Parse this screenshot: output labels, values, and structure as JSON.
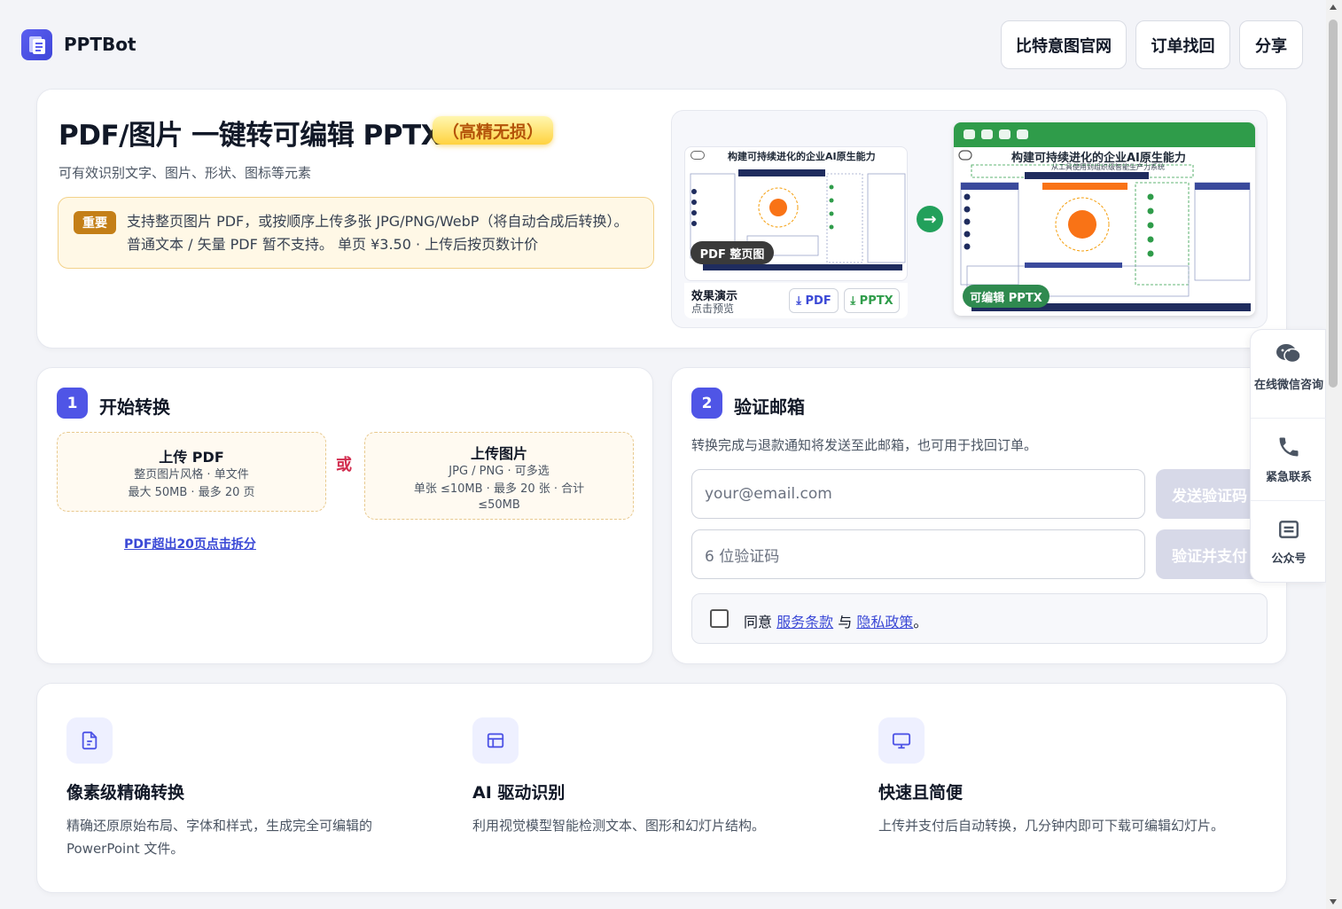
{
  "header": {
    "brand": "PPTBot",
    "buttons": [
      "比特意图官网",
      "订单找回",
      "分享"
    ]
  },
  "hero": {
    "title": "PDF/图片 一键转可编辑 PPTX",
    "badge": "（高精无损）",
    "subtitle": "可有效识别文字、图片、形状、图标等元素",
    "notice_tag": "重要",
    "notice_text": "支持整页图片 PDF，或按顺序上传多张 JPG/PNG/WebP（将自动合成后转换）。普通文本 / 矢量 PDF 暂不支持。 单页 ¥3.50 · 上传后按页数计价"
  },
  "preview": {
    "slide_title": "构建可持续进化的企业AI原生能力",
    "slide_subtitle": "从工具使用到组织级智能生产力系统",
    "left_caption": "PDF 整页图",
    "right_caption": "可编辑 PPTX",
    "demo_title": "效果演示",
    "demo_sub": "点击预览",
    "download_pdf": "⤓ PDF",
    "download_pptx": "⤓ PPTX"
  },
  "step1": {
    "num": "1",
    "title": "开始转换",
    "pdf_title": "上传 PDF",
    "pdf_line1": "整页图片风格 · 单文件",
    "pdf_line2": "最大 50MB · 最多 20 页",
    "or": "或",
    "img_title": "上传图片",
    "img_line1": "JPG / PNG · 可多选",
    "img_line2": "单张 ≤10MB · 最多 20 张 · 合计",
    "img_line3": "≤50MB",
    "split_link": "PDF超出20页点击拆分"
  },
  "step2": {
    "num": "2",
    "title": "验证邮箱",
    "desc": "转换完成与退款通知将发送至此邮箱，也可用于找回订单。",
    "email_placeholder": "your@email.com",
    "send_button": "发送验证码",
    "code_placeholder": "6 位验证码",
    "pay_button": "验证并支付",
    "agree_prefix": "同意",
    "terms": "服务条款",
    "and": "与",
    "privacy": "隐私政策",
    "agree_suffix": "。"
  },
  "features": [
    {
      "icon": "document-icon",
      "title": "像素级精确转换",
      "desc": "精确还原原始布局、字体和样式，生成完全可编辑的 PowerPoint 文件。"
    },
    {
      "icon": "layout-icon",
      "title": "AI 驱动识别",
      "desc": "利用视觉模型智能检测文本、图形和幻灯片结构。"
    },
    {
      "icon": "monitor-icon",
      "title": "快速且简便",
      "desc": "上传并支付后自动转换，几分钟内即可下载可编辑幻灯片。"
    }
  ],
  "side": {
    "wechat": "在线微信咨询",
    "urgent": "紧急联系",
    "official": "公众号"
  },
  "colors": {
    "accent": "#4f55e6",
    "badge": "#ffd23f",
    "success": "#22a05b",
    "link": "#3b49d6"
  }
}
